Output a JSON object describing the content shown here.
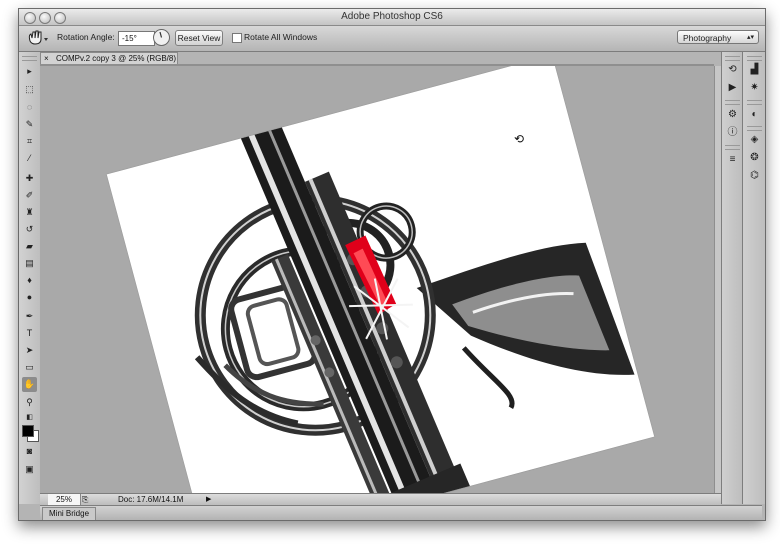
{
  "window": {
    "title": "Adobe Photoshop CS6"
  },
  "options_bar": {
    "tool_icon": "hand-icon",
    "rotation_label": "Rotation Angle:",
    "rotation_value": "-15°",
    "reset_label": "Reset View",
    "rotate_all_label": "Rotate All Windows",
    "rotate_all_checked": false,
    "workspace_value": "Photography"
  },
  "document": {
    "tab_label": "COMPv.2 copy 3 @ 25% (RGB/8)",
    "rotation_degrees": -15
  },
  "status": {
    "zoom": "25%",
    "doc_size": "Doc: 17.6M/14.1M"
  },
  "bottom_panel": {
    "tab_label": "Mini Bridge"
  },
  "tools": [
    "move-icon",
    "marquee-icon",
    "lasso-icon",
    "quick-select-icon",
    "crop-icon",
    "eyedropper-icon",
    "healing-brush-icon",
    "brush-icon",
    "clone-stamp-icon",
    "history-brush-icon",
    "eraser-icon",
    "gradient-icon",
    "blur-icon",
    "dodge-icon",
    "pen-icon",
    "type-icon",
    "path-select-icon",
    "rectangle-icon",
    "rotate-view-icon",
    "zoom-icon"
  ],
  "colors": {
    "foreground": "#000000",
    "background": "#ffffff",
    "accent": "#e0001a"
  }
}
